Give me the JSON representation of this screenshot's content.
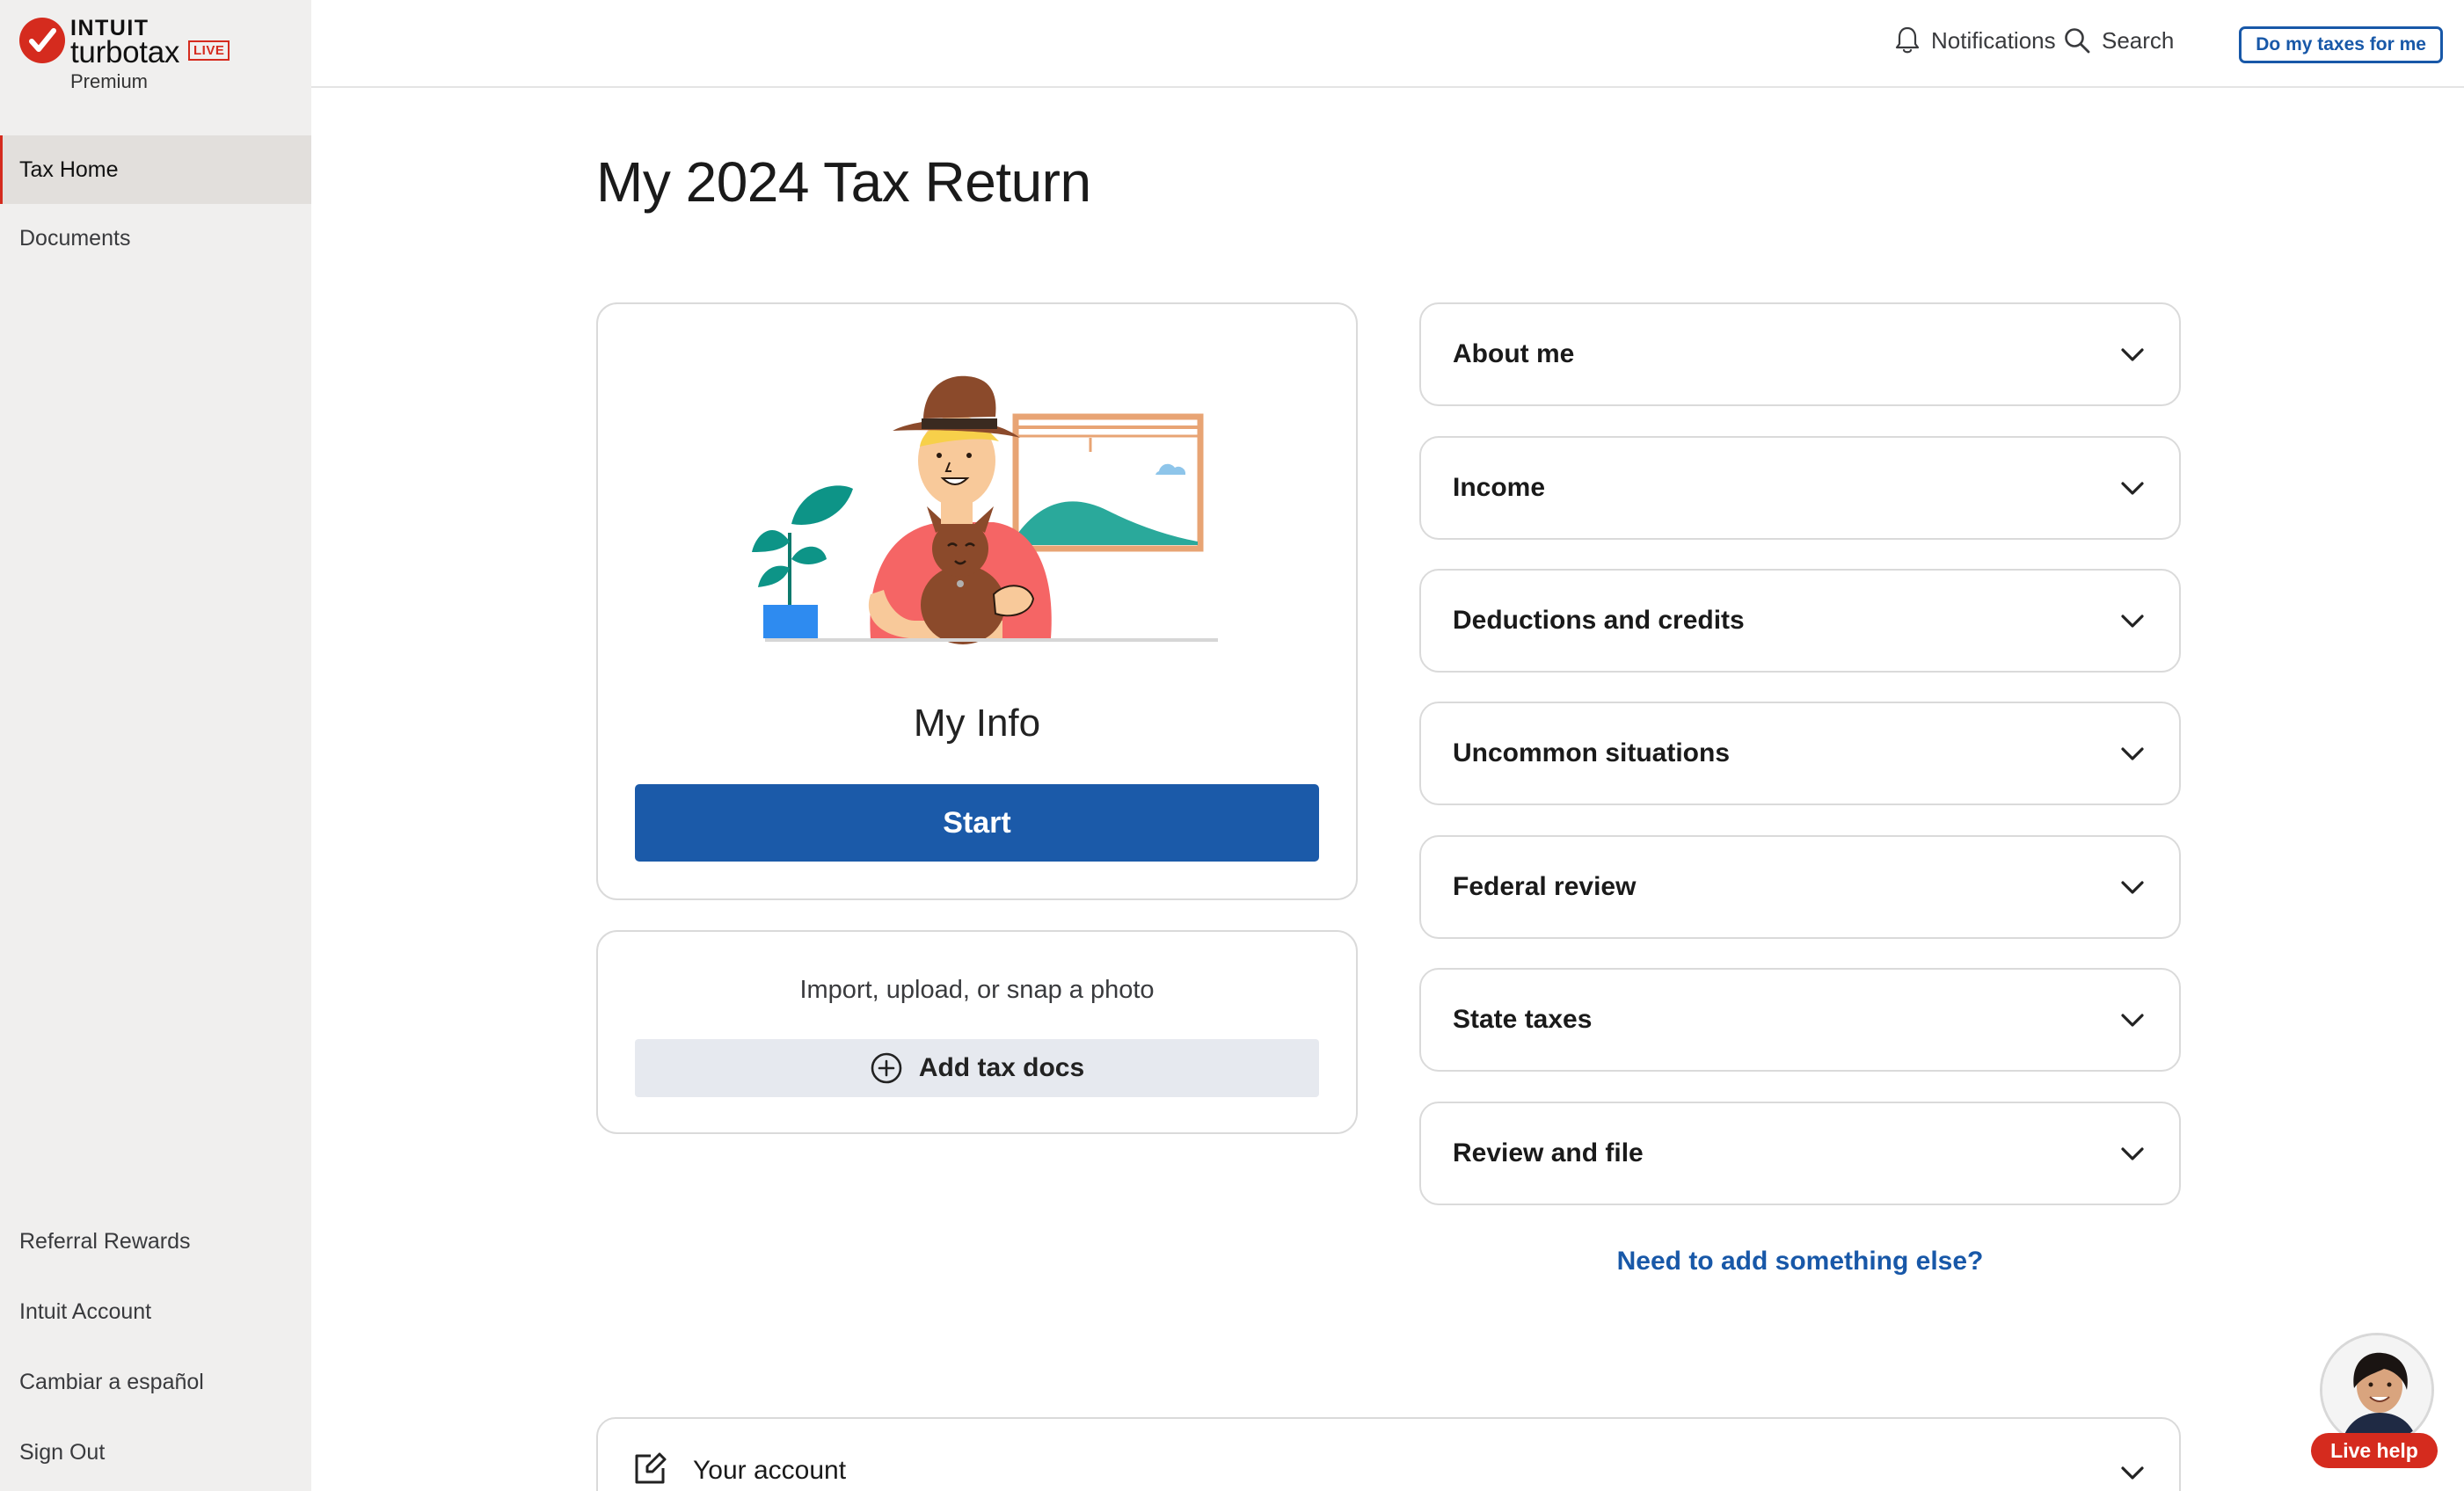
{
  "brand": {
    "company": "INTUIT",
    "product": "turbotax",
    "badge": "LIVE",
    "edition": "Premium",
    "accent_color": "#d52b1e",
    "primary_color": "#1b5aa9"
  },
  "sidebar": {
    "top_items": [
      {
        "label": "Tax Home",
        "active": true
      },
      {
        "label": "Documents",
        "active": false
      }
    ],
    "bottom_items": [
      {
        "label": "Referral Rewards"
      },
      {
        "label": "Intuit Account"
      },
      {
        "label": "Cambiar a español"
      },
      {
        "label": "Sign Out"
      }
    ]
  },
  "header": {
    "notifications_label": "Notifications",
    "search_label": "Search",
    "cta_label": "Do my taxes for me"
  },
  "main": {
    "title": "My 2024 Tax Return",
    "info_card": {
      "title": "My Info",
      "button_label": "Start"
    },
    "docs_card": {
      "text": "Import, upload, or snap a photo",
      "button_label": "Add tax docs"
    },
    "sections": [
      {
        "label": "About me"
      },
      {
        "label": "Income"
      },
      {
        "label": "Deductions and credits"
      },
      {
        "label": "Uncommon situations"
      },
      {
        "label": "Federal review"
      },
      {
        "label": "State taxes"
      },
      {
        "label": "Review and file"
      }
    ],
    "need_more_link": "Need to add something else?",
    "account_label": "Your account"
  },
  "live_help": {
    "label": "Live help"
  }
}
